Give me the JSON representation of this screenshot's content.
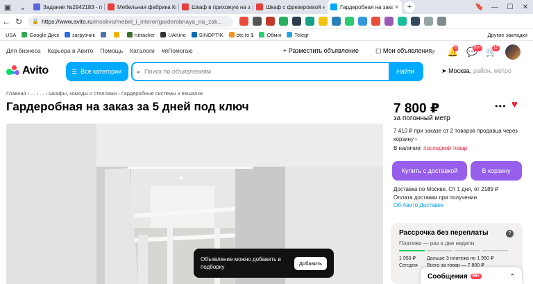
{
  "browser": {
    "tabs": [
      {
        "title": "Задание №2942183 - про",
        "color": "#5a67d8"
      },
      {
        "title": "Мебельная фабрика Кон",
        "color": "#e53e3e"
      },
      {
        "title": "Шкаф в прихожую на зак",
        "color": "#e53e3e"
      },
      {
        "title": "Шкаф с фрезеровкой на",
        "color": "#e53e3e"
      },
      {
        "title": "Гардеробная на заказ",
        "color": "#00aaff",
        "active": true
      }
    ],
    "new_tab": "+",
    "url_host": "https://www.avito.ru",
    "url_path": "/moskva/mebel_i_interer/garderobnaya_na_zak...",
    "bookmarks": [
      "USA",
      "Google Диск",
      "загрузчик",
      "",
      "",
      "rutracker",
      "UAKino",
      "",
      "SINOPTIK",
      "btc to $",
      "Обмін",
      "",
      "",
      "",
      "",
      "Telegr"
    ],
    "other_bookmarks": "Другие закладки"
  },
  "site": {
    "nav": [
      "Для бизнеса",
      "Карьера в Авито",
      "Помощь",
      "Каталоги",
      "#яПомогаю"
    ],
    "post_ad": "Разместить объявление",
    "my_ads": "Мои объявления",
    "badges": {
      "notifications": "6",
      "messages": "99+",
      "cart": "15"
    },
    "logo": "Avito",
    "categories_btn": "Все категории",
    "search_placeholder": "Поиск по объявлениям",
    "search_btn": "Найти",
    "location": "Москва,",
    "location_hint": "район, метро"
  },
  "listing": {
    "breadcrumbs": "Главная  ›  ...  ›  ...  ›  Шкафы, комоды и стеллажи  ›  Гардеробные системы и вешалки",
    "title": "Гардеробная на заказ за 5 дней под ключ",
    "price": "7 800 ₽",
    "price_unit": "за погонный метр",
    "price_note": "7 410 ₽ при заказе от 2 товаров продавца через корзину ›",
    "availability_label": "В наличии:",
    "availability_value": "последний товар",
    "buy_btn": "Купить с доставкой",
    "cart_btn": "В корзину",
    "delivery_line1": "Доставка по Москве. От 1 дня, от 2189 ₽",
    "delivery_line2": "Оплата доставки при получении",
    "delivery_link": "Об Авито Доставке",
    "installment_title": "Рассрочка без переплаты",
    "installment_sub": "Платежи — раз в две недели",
    "installment_first_amount": "1 950 ₽",
    "installment_first_when": "Сегодня",
    "installment_next": "Дальше 3 платежа по 1 950 ₽",
    "installment_total": "Всего за товар — 7 800 ₽"
  },
  "toast": {
    "text": "Объявление можно добавить в подборку",
    "button": "Добавить"
  },
  "messages_widget": {
    "label": "Сообщения",
    "badge": "99+"
  }
}
